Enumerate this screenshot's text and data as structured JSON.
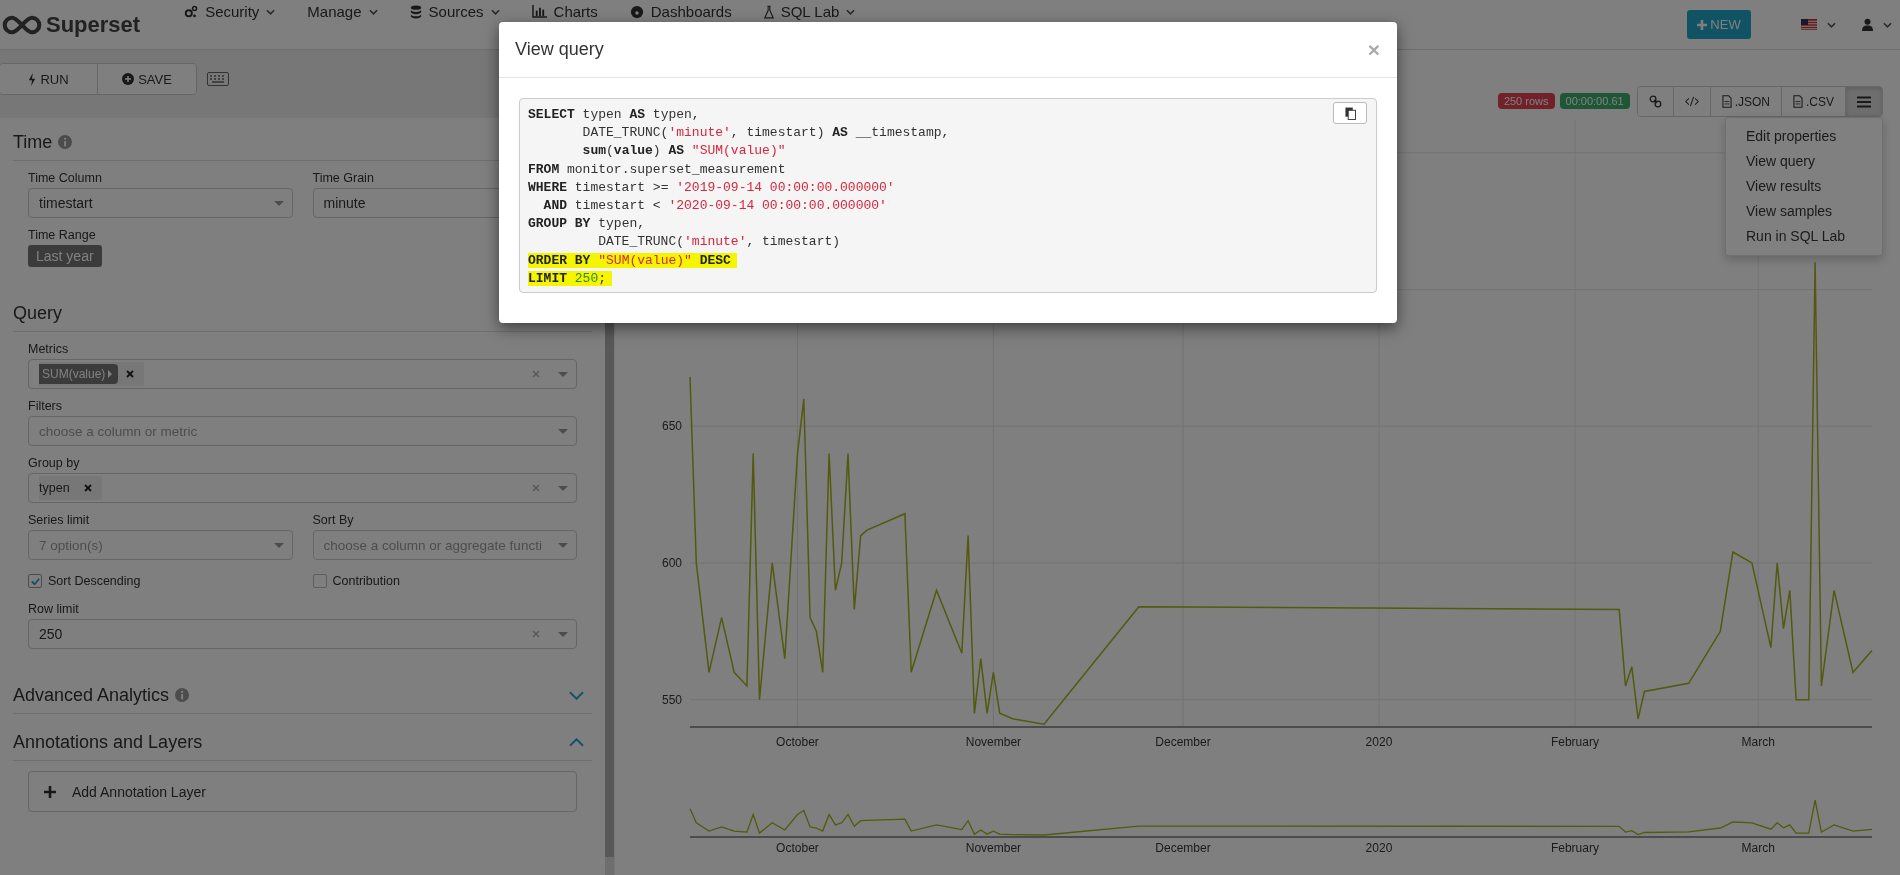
{
  "navbar": {
    "brand": "Superset",
    "menus": [
      {
        "label": "Security",
        "caret": true
      },
      {
        "label": "Manage",
        "caret": true
      },
      {
        "label": "Sources",
        "caret": true
      },
      {
        "label": "Charts",
        "caret": false
      },
      {
        "label": "Dashboards",
        "caret": false
      },
      {
        "label": "SQL Lab",
        "caret": true
      }
    ],
    "new_button": "NEW"
  },
  "controls_toolbar": {
    "buttons": [
      {
        "label": "RUN"
      },
      {
        "label": "SAVE"
      }
    ]
  },
  "sections": [
    {
      "title": "Time",
      "info": true,
      "rows": [
        [
          {
            "kind": "select",
            "label": "Time Column",
            "value": "timestart",
            "clearable": false
          },
          {
            "kind": "select",
            "label": "Time Grain",
            "value": "minute",
            "clearable": false
          }
        ],
        [
          {
            "kind": "tag",
            "label": "Time Range",
            "value": "Last year"
          }
        ]
      ]
    },
    {
      "title": "Query",
      "info": false,
      "rows": [
        [
          {
            "kind": "multi",
            "label": "Metrics",
            "tags": [
              {
                "label": "SUM(value)",
                "kind": "metric"
              }
            ],
            "clearable": true
          }
        ],
        [
          {
            "kind": "select",
            "label": "Filters",
            "placeholder": "choose a column or metric",
            "clearable": false
          }
        ],
        [
          {
            "kind": "multi",
            "label": "Group by",
            "tags": [
              {
                "label": "typen",
                "kind": "column"
              }
            ],
            "clearable": true
          }
        ],
        [
          {
            "kind": "select",
            "label": "Series limit",
            "placeholder": "7 option(s)",
            "clearable": false
          },
          {
            "kind": "select",
            "label": "Sort By",
            "placeholder": "choose a column or aggregate functi",
            "clearable": false
          }
        ],
        [
          {
            "kind": "checkbox",
            "label": "Sort Descending",
            "checked": true
          },
          {
            "kind": "checkbox",
            "label": "Contribution",
            "checked": false
          }
        ],
        [
          {
            "kind": "select",
            "label": "Row limit",
            "value": "250",
            "clearable": true
          }
        ]
      ]
    },
    {
      "title": "Advanced Analytics",
      "info": true,
      "expanded": false
    },
    {
      "title": "Annotations and Layers",
      "info": false,
      "expanded": true,
      "rows": [
        [
          {
            "kind": "add",
            "label": "Add Annotation Layer"
          }
        ]
      ]
    }
  ],
  "chart_header": {
    "badges": [
      {
        "label": "250 rows",
        "kind": "danger"
      },
      {
        "label": "00:00:00.61",
        "kind": "success"
      }
    ],
    "buttons": [
      {
        "kind": "link"
      },
      {
        "kind": "code"
      },
      {
        "kind": "export",
        "label": ".JSON"
      },
      {
        "kind": "export",
        "label": ".CSV"
      },
      {
        "kind": "menu",
        "selected": true
      }
    ],
    "menu": [
      "Edit properties",
      "View query",
      "View results",
      "View samples",
      "Run in SQL Lab"
    ]
  },
  "chart": {
    "chart_data": {
      "type": "line",
      "grid": true,
      "ylim": [
        540,
        762
      ],
      "yticks": [
        550,
        600,
        650
      ],
      "categories": [
        null,
        null,
        null,
        null,
        null,
        null,
        null,
        null,
        null,
        null,
        null,
        null,
        null,
        null,
        null,
        null,
        null,
        "October",
        null,
        null,
        null,
        null,
        null,
        null,
        null,
        null,
        null,
        null,
        null,
        null,
        null,
        null,
        null,
        null,
        null,
        null,
        null,
        null,
        null,
        null,
        null,
        null,
        null,
        null,
        null,
        null,
        null,
        null,
        "November",
        null,
        null,
        null,
        null,
        null,
        null,
        null,
        null,
        null,
        null,
        null,
        null,
        null,
        null,
        null,
        null,
        null,
        null,
        null,
        null,
        null,
        null,
        null,
        null,
        null,
        null,
        null,
        null,
        null,
        "December",
        null,
        null,
        null,
        null,
        null,
        null,
        null,
        null,
        null,
        null,
        null,
        null,
        null,
        null,
        null,
        null,
        null,
        null,
        null,
        null,
        null,
        null,
        null,
        null,
        null,
        null,
        null,
        null,
        null,
        null,
        "2020",
        null,
        null,
        null,
        null,
        null,
        null,
        null,
        null,
        null,
        null,
        null,
        null,
        null,
        null,
        null,
        null,
        null,
        null,
        null,
        null,
        null,
        null,
        null,
        null,
        null,
        null,
        null,
        null,
        null,
        null,
        "February",
        null,
        null,
        null,
        null,
        null,
        null,
        null,
        null,
        null,
        null,
        null,
        null,
        null,
        null,
        null,
        null,
        null,
        null,
        null,
        null,
        null,
        null,
        null,
        null,
        null,
        null,
        null,
        null,
        "March",
        null,
        null,
        null,
        null,
        null,
        null,
        null,
        null,
        null,
        null,
        null,
        null,
        null,
        null,
        null,
        null,
        null,
        null
      ],
      "series": [
        {
          "color": "#535a0d",
          "values": [
            668,
            600,
            null,
            560,
            null,
            580,
            null,
            560,
            null,
            555,
            640,
            550,
            null,
            600,
            null,
            565,
            null,
            640,
            660,
            580,
            575,
            560,
            640,
            590,
            600,
            640,
            583,
            610,
            612,
            null,
            null,
            null,
            null,
            null,
            618,
            560,
            null,
            null,
            null,
            590,
            null,
            null,
            null,
            567,
            610,
            545,
            565,
            545,
            560,
            545,
            null,
            543,
            null,
            null,
            null,
            null,
            541,
            null,
            null,
            null,
            null,
            null,
            null,
            null,
            null,
            null,
            null,
            null,
            null,
            null,
            null,
            584,
            null,
            null,
            null,
            null,
            null,
            null,
            null,
            null,
            null,
            null,
            null,
            null,
            null,
            null,
            null,
            null,
            null,
            null,
            null,
            null,
            null,
            null,
            null,
            null,
            null,
            null,
            null,
            null,
            null,
            null,
            null,
            null,
            null,
            null,
            null,
            null,
            null,
            null,
            null,
            null,
            null,
            null,
            null,
            null,
            null,
            null,
            null,
            null,
            null,
            null,
            null,
            null,
            null,
            null,
            null,
            null,
            null,
            null,
            null,
            null,
            null,
            null,
            null,
            null,
            null,
            null,
            null,
            null,
            null,
            null,
            null,
            null,
            null,
            null,
            null,
            583,
            555,
            562,
            543,
            553,
            null,
            null,
            null,
            null,
            null,
            null,
            556,
            null,
            null,
            null,
            null,
            575,
            null,
            604,
            null,
            null,
            600,
            null,
            null,
            569,
            600,
            576,
            590,
            550,
            null,
            550,
            710,
            555,
            null,
            590,
            null,
            null,
            560,
            null,
            null,
            568
          ]
        }
      ]
    },
    "overview_labels": [
      "October",
      "November",
      "December",
      "2020",
      "February",
      "March"
    ]
  },
  "modal": {
    "title": "View query",
    "close": "×",
    "lines": [
      {
        "highlighted": false,
        "tokens": [
          {
            "kind": "keyword",
            "text": "SELECT"
          },
          {
            "kind": "plain",
            "text": " typen "
          },
          {
            "kind": "keyword",
            "text": "AS"
          },
          {
            "kind": "plain",
            "text": " typen,"
          }
        ]
      },
      {
        "highlighted": false,
        "tokens": [
          {
            "kind": "plain",
            "text": "       DATE_TRUNC("
          },
          {
            "kind": "string",
            "text": "'minute'"
          },
          {
            "kind": "plain",
            "text": ", timestart) "
          },
          {
            "kind": "keyword",
            "text": "AS"
          },
          {
            "kind": "plain",
            "text": " __timestamp,"
          }
        ]
      },
      {
        "highlighted": false,
        "tokens": [
          {
            "kind": "keyword",
            "text": "       sum"
          },
          {
            "kind": "plain",
            "text": "("
          },
          {
            "kind": "keyword",
            "text": "value"
          },
          {
            "kind": "plain",
            "text": ") "
          },
          {
            "kind": "keyword",
            "text": "AS"
          },
          {
            "kind": "string",
            "text": " \"SUM(value)\""
          }
        ]
      },
      {
        "highlighted": false,
        "tokens": [
          {
            "kind": "keyword",
            "text": "FROM"
          },
          {
            "kind": "plain",
            "text": " monitor.superset_measurement"
          }
        ]
      },
      {
        "highlighted": false,
        "tokens": [
          {
            "kind": "keyword",
            "text": "WHERE"
          },
          {
            "kind": "plain",
            "text": " timestart >= "
          },
          {
            "kind": "string",
            "text": "'2019-09-14 00:00:00.000000'"
          }
        ]
      },
      {
        "highlighted": false,
        "tokens": [
          {
            "kind": "keyword",
            "text": "  AND"
          },
          {
            "kind": "plain",
            "text": " timestart < "
          },
          {
            "kind": "string",
            "text": "'2020-09-14 00:00:00.000000'"
          }
        ]
      },
      {
        "highlighted": false,
        "tokens": [
          {
            "kind": "keyword",
            "text": "GROUP BY"
          },
          {
            "kind": "plain",
            "text": " typen,"
          }
        ]
      },
      {
        "highlighted": false,
        "tokens": [
          {
            "kind": "plain",
            "text": "         DATE_TRUNC("
          },
          {
            "kind": "string",
            "text": "'minute'"
          },
          {
            "kind": "plain",
            "text": ", timestart)"
          }
        ]
      },
      {
        "highlighted": true,
        "tokens": [
          {
            "kind": "keyword",
            "text": "ORDER BY"
          },
          {
            "kind": "string",
            "text": " \"SUM(value)\""
          },
          {
            "kind": "keyword",
            "text": " DESC"
          }
        ]
      },
      {
        "highlighted": true,
        "tokens": [
          {
            "kind": "keyword",
            "text": "LIMIT"
          },
          {
            "kind": "number",
            "text": " 250"
          },
          {
            "kind": "plain",
            "text": ";"
          }
        ]
      }
    ]
  }
}
